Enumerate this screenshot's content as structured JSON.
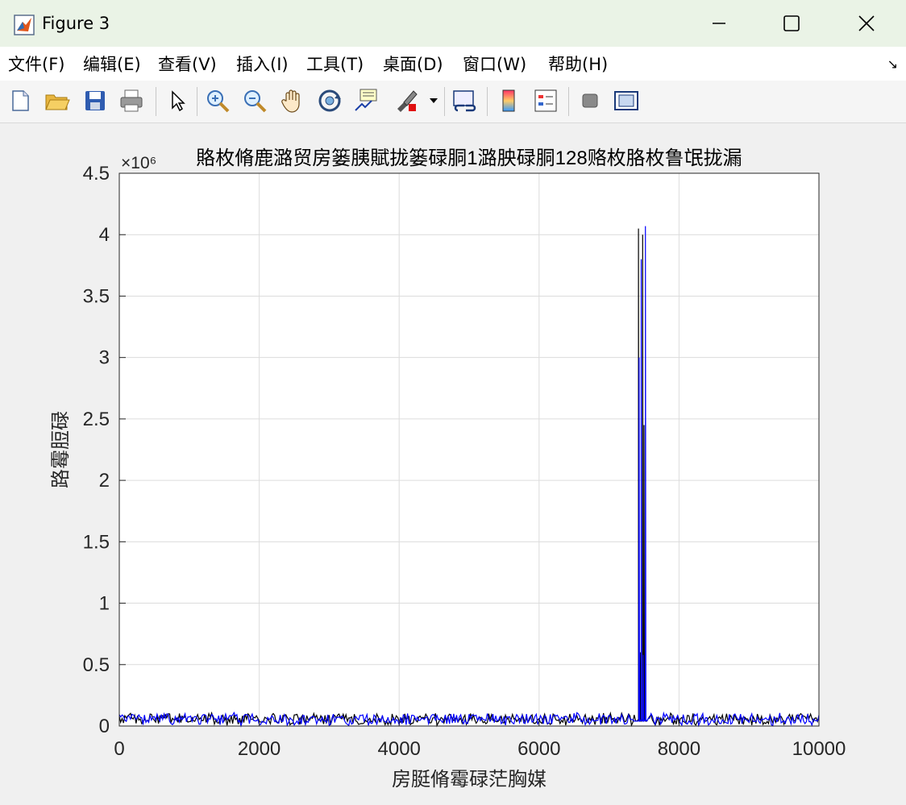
{
  "window": {
    "title": "Figure 3"
  },
  "menu": [
    {
      "label": "文件(F)"
    },
    {
      "label": "编辑(E)"
    },
    {
      "label": "查看(V)"
    },
    {
      "label": "插入(I)"
    },
    {
      "label": "工具(T)"
    },
    {
      "label": "桌面(D)"
    },
    {
      "label": "窗口(W)"
    },
    {
      "label": "帮助(H)"
    }
  ],
  "toolbar": {
    "icons": [
      "new-figure-icon",
      "open-file-icon",
      "save-icon",
      "print-icon",
      "pointer-icon",
      "zoom-in-icon",
      "zoom-out-icon",
      "pan-hand-icon",
      "rotate-3d-icon",
      "data-cursor-icon",
      "brush-icon",
      "link-plot-icon",
      "colorbar-icon",
      "legend-icon",
      "hide-plot-tools-icon",
      "show-plot-tools-icon"
    ]
  },
  "colors": {
    "series1": "#000000",
    "series2": "#0000ff",
    "grid": "#dcdcdc"
  },
  "chart_data": {
    "type": "line",
    "title": "賂枚脩鹿潞贸房篓胰賦拢篓碌胴1潞胦碌胴128赂枚胳枚鲁氓拢漏",
    "xlabel": "房脡脩霉碌茫胸媒",
    "ylabel": "路霉脰碌",
    "exponent_label": "×10⁶",
    "xlim": [
      0,
      10000
    ],
    "ylim": [
      0,
      4.5
    ],
    "xticks": [
      "0",
      "2000",
      "4000",
      "6000",
      "8000",
      "10000"
    ],
    "yticks": [
      "0",
      "0.5",
      "1",
      "1.5",
      "2",
      "2.5",
      "3",
      "3.5",
      "4",
      "4.5"
    ],
    "grid": true,
    "noise_level": 0.05,
    "series": [
      {
        "color": "#000000",
        "peaks": [
          [
            7420,
            4.05
          ],
          [
            7450,
            0.6
          ],
          [
            7480,
            4.0
          ],
          [
            7500,
            2.45
          ]
        ]
      },
      {
        "color": "#0000ff",
        "peaks": [
          [
            7430,
            3.0
          ],
          [
            7460,
            3.8
          ],
          [
            7490,
            0.58
          ],
          [
            7520,
            4.07
          ]
        ]
      }
    ]
  }
}
